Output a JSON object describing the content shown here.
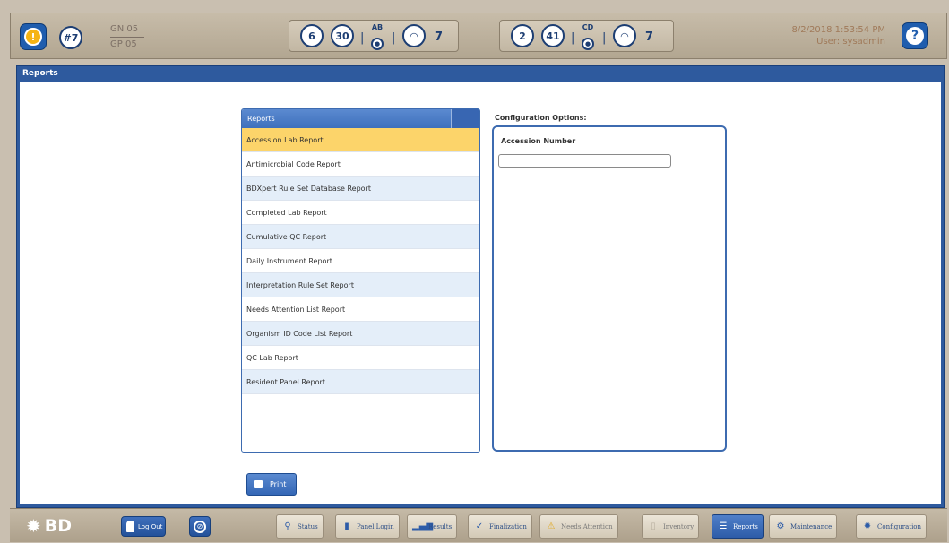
{
  "topbar": {
    "alert_icon": "warning-icon",
    "count_badge": "#7",
    "gn": "GN 05",
    "gp": "GP 05",
    "group1": {
      "a": "6",
      "b": "30",
      "lock_label": "AB",
      "c": "7"
    },
    "group2": {
      "a": "2",
      "b": "41",
      "lock_label": "CD",
      "c": "7"
    },
    "datetime": "8/2/2018 1:53:54 PM",
    "user": "User: sysadmin",
    "help": "?"
  },
  "window": {
    "title": "Reports"
  },
  "reports": {
    "header": "Reports",
    "items": [
      "Accession Lab Report",
      "Antimicrobial Code Report",
      "BDXpert Rule Set Database Report",
      "Completed Lab Report",
      "Cumulative QC Report",
      "Daily Instrument Report",
      "Interpretation Rule Set Report",
      "Needs Attention List Report",
      "Organism ID Code List Report",
      "QC Lab Report",
      "Resident Panel Report"
    ],
    "selected_index": 0
  },
  "config": {
    "label": "Configuration Options:",
    "field_label": "Accession Number",
    "field_value": ""
  },
  "print_label": "Print",
  "bottombar": {
    "logo": "BD",
    "logout_label": "Log Out",
    "nav": {
      "status": "Status",
      "panel_login": "Panel Login",
      "results": "Results",
      "finalization": "Finalization",
      "needs_attention": "Needs Attention",
      "inventory": "Inventory",
      "reports": "Reports",
      "maintenance": "Maintenance",
      "configuration": "Configuration"
    },
    "active": "reports"
  }
}
